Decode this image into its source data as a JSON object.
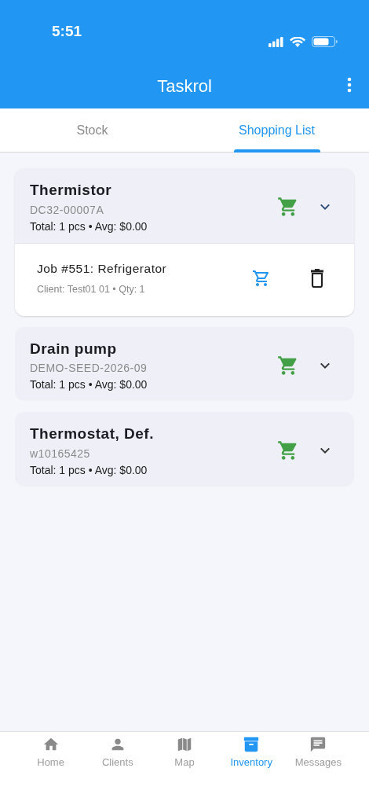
{
  "status_bar": {
    "time": "5:51"
  },
  "app_bar": {
    "title": "Taskrol"
  },
  "tabs": [
    {
      "label": "Stock",
      "selected": false
    },
    {
      "label": "Shopping List",
      "selected": true
    }
  ],
  "items": [
    {
      "name": "Thermistor",
      "part_number": "DC32-00007A",
      "summary": "Total: 1 pcs • Avg: $0.00",
      "expanded": true,
      "jobs": [
        {
          "title": "Job #551: Refrigerator",
          "detail": "Client: Test01 01 • Qty: 1"
        }
      ]
    },
    {
      "name": "Drain pump",
      "part_number": "DEMO-SEED-2026-09",
      "summary": "Total: 1 pcs • Avg: $0.00",
      "expanded": false
    },
    {
      "name": "Thermostat, Def.",
      "part_number": "w10165425",
      "summary": "Total: 1 pcs • Avg: $0.00",
      "expanded": false
    }
  ],
  "bottom_nav": [
    {
      "kind": "home",
      "label": "Home",
      "selected": false
    },
    {
      "kind": "clients",
      "label": "Clients",
      "selected": false
    },
    {
      "kind": "map",
      "label": "Map",
      "selected": false
    },
    {
      "kind": "inventory",
      "label": "Inventory",
      "selected": true
    },
    {
      "kind": "messages",
      "label": "Messages",
      "selected": false
    }
  ]
}
